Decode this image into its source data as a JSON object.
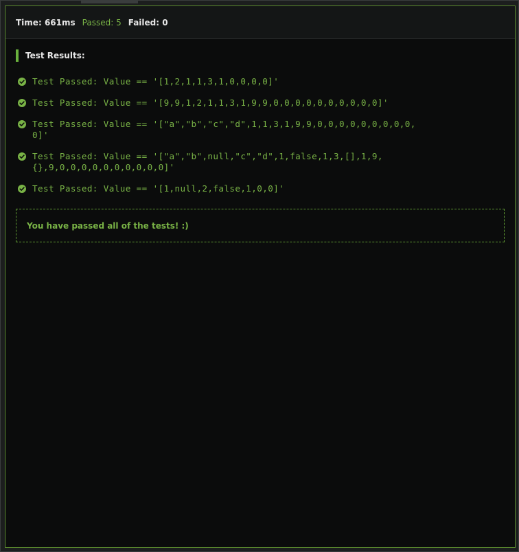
{
  "header": {
    "time_label": "Time:",
    "time_value": "661ms",
    "passed_label": "Passed:",
    "passed_value": "5",
    "failed_label": "Failed:",
    "failed_value": "0"
  },
  "results": {
    "title": "Test Results:",
    "items": [
      {
        "text": "Test Passed: Value == '[1,2,1,1,3,1,0,0,0,0]'"
      },
      {
        "text": "Test Passed: Value == '[9,9,1,2,1,1,3,1,9,9,0,0,0,0,0,0,0,0,0,0]'"
      },
      {
        "text": "Test Passed: Value == '[\"a\",\"b\",\"c\",\"d\",1,1,3,1,9,9,0,0,0,0,0,0,0,0,0,0]'"
      },
      {
        "text": "Test Passed: Value == '[\"a\",\"b\",null,\"c\",\"d\",1,false,1,3,[],1,9,\n{},9,0,0,0,0,0,0,0,0,0,0]'"
      },
      {
        "text": "Test Passed: Value == '[1,null,2,false,1,0,0]'"
      }
    ],
    "icon": "check-circle-icon"
  },
  "summary": {
    "message": "You have passed all of the tests! :)"
  },
  "colors": {
    "pass": "#79b346",
    "accent_border": "#5a8a2e",
    "background": "#0b0c0c"
  }
}
